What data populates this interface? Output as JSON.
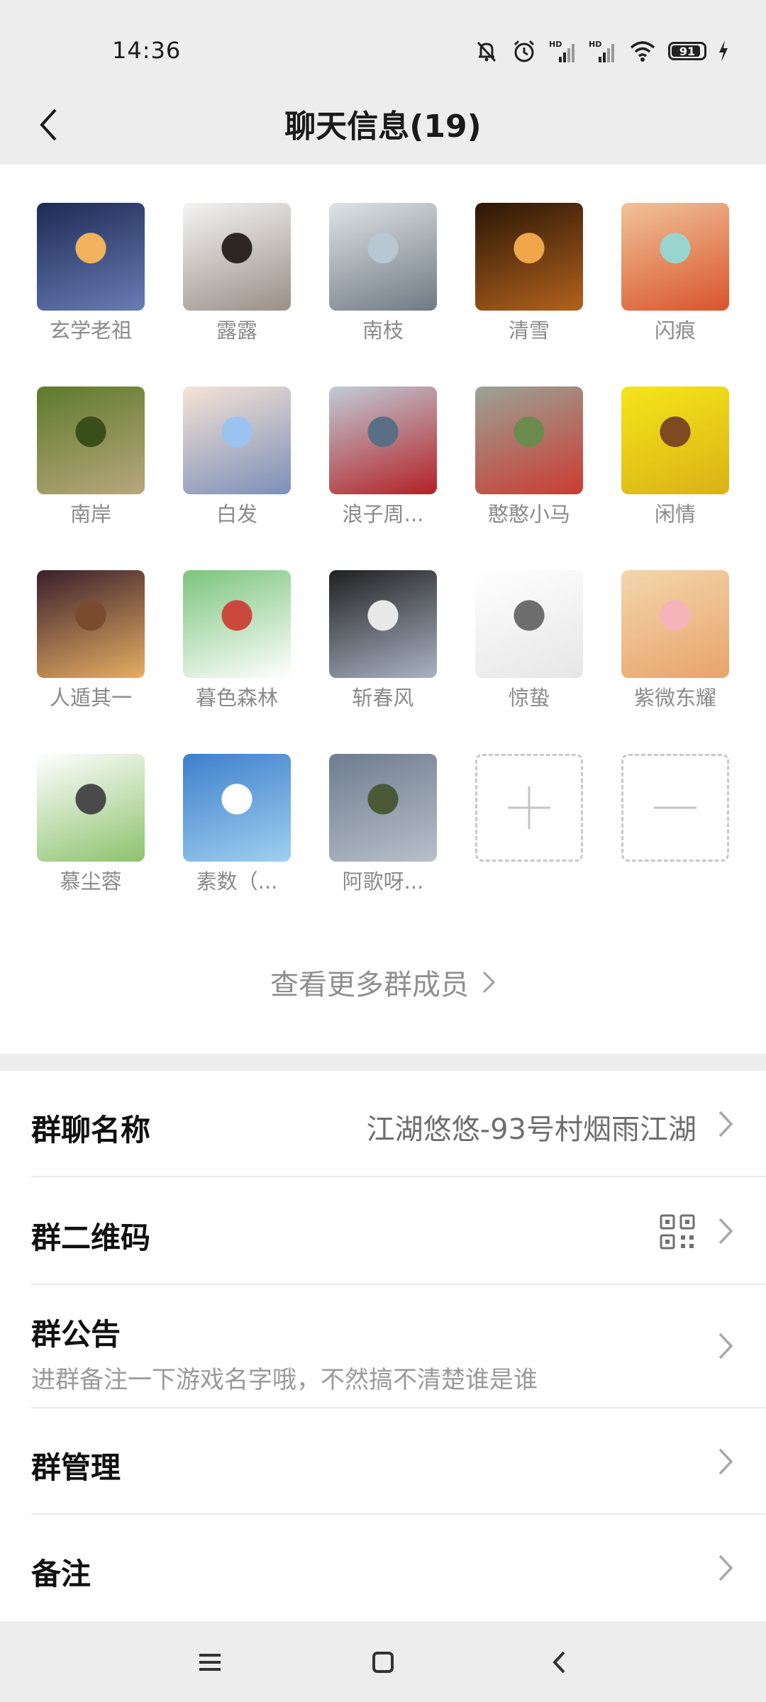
{
  "status_bar": {
    "time": "14:36",
    "battery": "91",
    "icons": [
      "bell-off-icon",
      "alarm-icon",
      "hd-signal-icon",
      "hd-signal-icon",
      "wifi-icon",
      "battery-icon",
      "charging-icon"
    ]
  },
  "header": {
    "title": "聊天信息(19)",
    "back_icon": "chevron-left-icon"
  },
  "members": [
    {
      "name": "玄学老祖",
      "colors": [
        "#1c2a55",
        "#6a7cb4",
        "#f2b35c"
      ]
    },
    {
      "name": "露露",
      "colors": [
        "#f4f4f4",
        "#9a8f86",
        "#2d2622"
      ]
    },
    {
      "name": "南枝",
      "colors": [
        "#dfe3e6",
        "#6f7a84",
        "#b9c7d3"
      ]
    },
    {
      "name": "清雪",
      "colors": [
        "#2a1606",
        "#b3621d",
        "#f0a64a"
      ]
    },
    {
      "name": "闪痕",
      "colors": [
        "#f1c39a",
        "#d9542b",
        "#9ad4cf"
      ]
    },
    {
      "name": "南岸",
      "colors": [
        "#5d7a2c",
        "#b9a77c",
        "#3a4e1a"
      ]
    },
    {
      "name": "白发",
      "colors": [
        "#f5e3d6",
        "#7c8fb8",
        "#9ac3f0"
      ]
    },
    {
      "name": "浪子周...",
      "colors": [
        "#c0ccd8",
        "#b32025",
        "#5a6f86"
      ]
    },
    {
      "name": "憨憨小马",
      "colors": [
        "#9aa396",
        "#cc3b32",
        "#6d8b4e"
      ]
    },
    {
      "name": "闲情",
      "colors": [
        "#f6e51a",
        "#d9b216",
        "#7d4a22"
      ]
    },
    {
      "name": "人遁其一",
      "colors": [
        "#3a1f2c",
        "#e6ae62",
        "#7b4b2f"
      ]
    },
    {
      "name": "暮色森林",
      "colors": [
        "#7cc47d",
        "#ffffff",
        "#c94a3c"
      ]
    },
    {
      "name": "斩春风",
      "colors": [
        "#202020",
        "#aab3c4",
        "#e8e8e8"
      ]
    },
    {
      "name": "惊蛰",
      "colors": [
        "#ffffff",
        "#e6e6e6",
        "#6d6d6d"
      ]
    },
    {
      "name": "紫微东耀",
      "colors": [
        "#f3d6ad",
        "#e8a46a",
        "#f4b4b9"
      ]
    },
    {
      "name": "慕尘蓉",
      "colors": [
        "#ffffff",
        "#8dc26d",
        "#4a4a4a"
      ]
    },
    {
      "name": "素数（...",
      "colors": [
        "#3f7fcc",
        "#9fd0f0",
        "#ffffff"
      ]
    },
    {
      "name": "阿歌呀...",
      "colors": [
        "#6e7c90",
        "#b8c0c9",
        "#4a5a38"
      ]
    }
  ],
  "add_member_icon": "plus-icon",
  "remove_member_icon": "minus-icon",
  "more_members_label": "查看更多群成员",
  "settings": {
    "group_name": {
      "label": "群聊名称",
      "value": "江湖悠悠-93号村烟雨江湖"
    },
    "qr_code": {
      "label": "群二维码",
      "icon": "qr-code-icon"
    },
    "announcement": {
      "label": "群公告",
      "text": "进群备注一下游戏名字哦，不然搞不清楚谁是谁"
    },
    "management": {
      "label": "群管理"
    },
    "remark": {
      "label": "备注"
    }
  },
  "nav_buttons": [
    "menu-icon",
    "home-icon",
    "back-icon"
  ]
}
